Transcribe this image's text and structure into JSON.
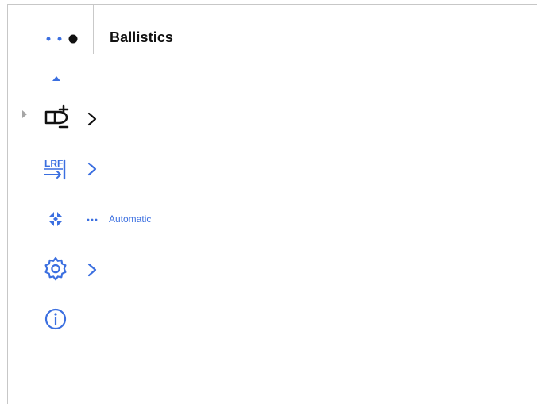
{
  "header": {
    "title": "Ballistics",
    "dots_icon": "page-dots-icon"
  },
  "menu": {
    "items": [
      {
        "icon": "ammo-add-remove-icon",
        "has_chevron": true,
        "value": ""
      },
      {
        "icon": "lrf-icon",
        "icon_text": "LRF",
        "has_chevron": true,
        "value": ""
      },
      {
        "icon": "zoom-target-icon",
        "has_chevron": false,
        "value": "Automatic"
      },
      {
        "icon": "gear-icon",
        "has_chevron": true,
        "value": ""
      },
      {
        "icon": "info-icon",
        "has_chevron": false,
        "value": ""
      }
    ]
  },
  "colors": {
    "accent": "#3b6fe0",
    "text": "#111111",
    "divider": "#c9c9c9",
    "frame": "#c7c7c7"
  }
}
